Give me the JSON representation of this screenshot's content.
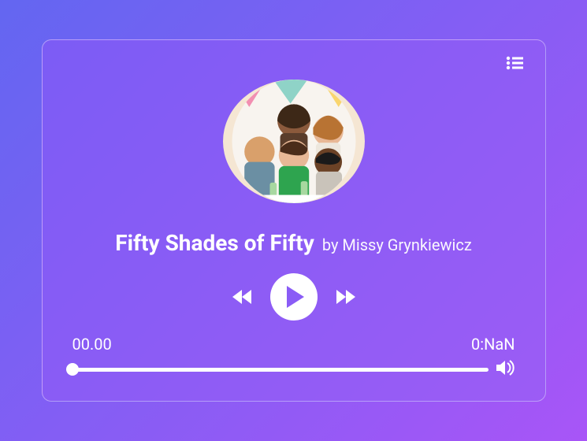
{
  "track": {
    "title": "Fifty Shades of Fifty",
    "artist_prefix": "by",
    "artist": "Missy Grynkiewicz"
  },
  "time": {
    "current": "00.00",
    "duration": "0:NaN"
  },
  "icons": {
    "playlist": "playlist-icon",
    "rewind": "rewind-icon",
    "play": "play-icon",
    "forward": "forward-icon",
    "volume": "volume-icon"
  },
  "colors": {
    "accent": "#8a5cf6",
    "play_fill": "#8a5cf6"
  }
}
